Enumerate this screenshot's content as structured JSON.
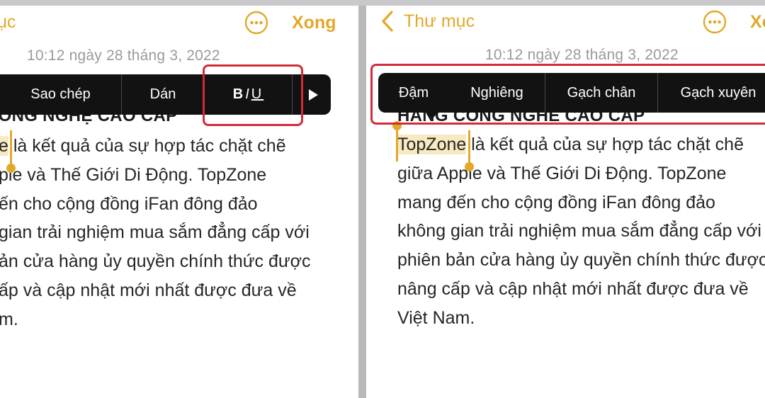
{
  "left": {
    "nav": {
      "back_label": "ục",
      "done_label": "Xong",
      "more_icon": "ellipsis-circle-icon"
    },
    "timestamp": "10:12 ngày 28 tháng 3, 2022",
    "menu": {
      "copy": "Sao chép",
      "paste": "Dán",
      "format": "BIU",
      "format_bold": "B",
      "format_italic": "I",
      "format_underline": "U",
      "next_icon": "play-arrow-icon"
    },
    "heading": "CÔNG NGHỆ CAO CẤP",
    "lines": [
      {
        "selected": "e",
        "rest": " là kết quả của sự hợp tác chặt chẽ"
      },
      {
        "text": "ple và Thế Giới Di Động. TopZone"
      },
      {
        "text": "ến cho cộng đồng iFan đông đảo"
      },
      {
        "text": "gian trải nghiệm mua sắm đẳng cấp với"
      },
      {
        "text": "ản cửa hàng ủy quyền chính thức được"
      },
      {
        "text": "ấp và cập nhật mới nhất được đưa về"
      },
      {
        "text": "m."
      }
    ]
  },
  "right": {
    "nav": {
      "back_icon": "chevron-left-icon",
      "back_label": "Thư mục",
      "done_label": "Xo",
      "more_icon": "ellipsis-circle-icon"
    },
    "timestamp": "10:12 ngày 28 tháng 3, 2022",
    "menu": {
      "bold": "Đậm",
      "italic": "Nghiêng",
      "underline": "Gạch chân",
      "strike": "Gạch xuyên"
    },
    "heading": "HÀNG CÔNG NGHỆ CAO CẤP",
    "lines": [
      {
        "selected": "TopZone",
        "rest": " là kết quả của sự hợp tác chặt chẽ"
      },
      {
        "text": "giữa Apple và Thế Giới Di Động. TopZone"
      },
      {
        "text": "mang đến cho cộng đồng iFan đông đảo"
      },
      {
        "text": "không gian trải nghiệm mua sắm đẳng cấp với"
      },
      {
        "text": "phiên bản cửa hàng ủy quyền chính thức được"
      },
      {
        "text": "nâng cấp và cập nhật mới nhất được đưa về"
      },
      {
        "text": "Việt Nam."
      }
    ]
  },
  "colors": {
    "accent": "#e2a82a",
    "highlight_box": "#d42a37",
    "selection": "#f7e9c0",
    "menu_bg": "#121212"
  }
}
